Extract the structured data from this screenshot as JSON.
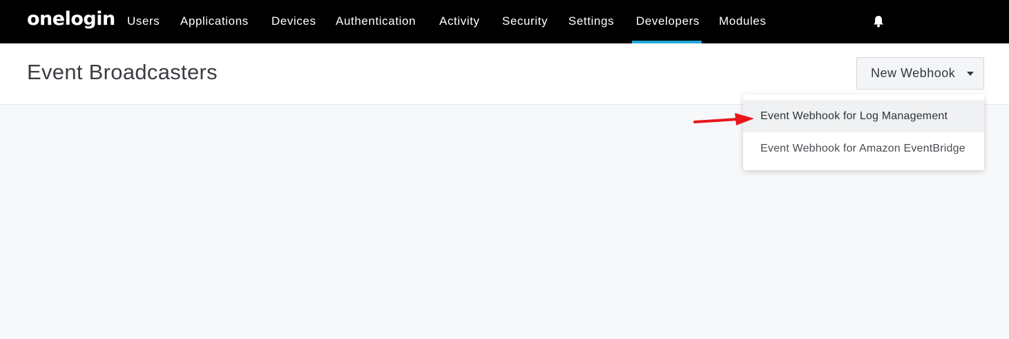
{
  "app": {
    "logo_text": "onelogin"
  },
  "nav": {
    "items": [
      {
        "label": "Users"
      },
      {
        "label": "Applications"
      },
      {
        "label": "Devices"
      },
      {
        "label": "Authentication"
      },
      {
        "label": "Activity"
      },
      {
        "label": "Security"
      },
      {
        "label": "Settings"
      },
      {
        "label": "Developers",
        "active": true
      },
      {
        "label": "Modules"
      }
    ],
    "active_color": "#1ea7d8",
    "notifications_icon": "bell-icon"
  },
  "page": {
    "title": "Event Broadcasters"
  },
  "new_webhook": {
    "label": "New Webhook",
    "icon": "caret-down-icon",
    "options": [
      {
        "label": "Event Webhook for Log Management",
        "highlighted": true
      },
      {
        "label": "Event Webhook for Amazon EventBridge"
      }
    ]
  },
  "annotation": {
    "arrow_color": "#e8161b",
    "icon": "red-arrow-annotation"
  }
}
